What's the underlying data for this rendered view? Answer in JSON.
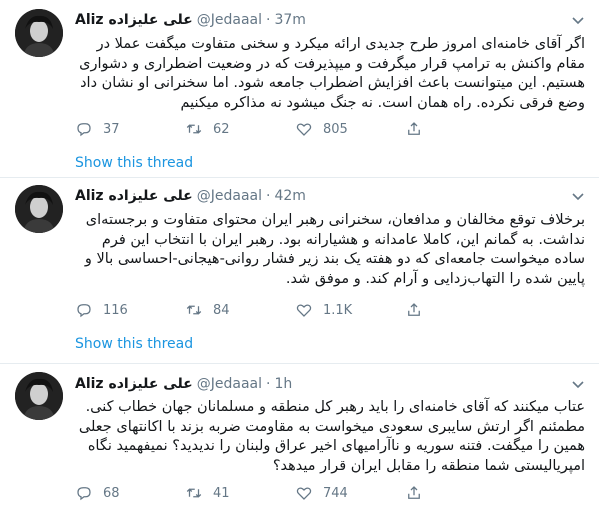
{
  "tweets": [
    {
      "name": "Aliz علی علیزاده",
      "handle": "@Jedaaal",
      "sep": "·",
      "time": "37m",
      "text": "اگر آقای خامنه‌ای امروز طرح جدیدی ارائه میکرد و سخنی متفاوت میگفت عملا در مقام واکنش به ترامپ قرار میگرفت و میپذیرفت که در وضعیت اضطراری و دشواری هستیم. این میتوانست باعث افزایش اضطراب جامعه شود. اما سخنرانی او نشان داد وضع فرقی نکرده. راه همان است. نه جنگ میشود نه مذاکره میکنیم",
      "reply_count": "37",
      "retweet_count": "62",
      "like_count": "805",
      "show_thread": "Show this thread"
    },
    {
      "name": "Aliz علی علیزاده",
      "handle": "@Jedaaal",
      "sep": "·",
      "time": "42m",
      "text": "برخلاف توقع مخالفان و مدافعان، سخنرانی رهبر ایران محتوای متفاوت و برجسته‌ای نداشت. به گمانم این، کاملا عامدانه و هشیارانه بود. رهبر ایران با انتخاب این فرم ساده میخواست جامعه‌ای که دو هفته یک بند زیر فشار روانی-هیجانی-احساسی بالا و پایین شده را التهاب‌زدایی و آرام کند. و موفق شد.",
      "reply_count": "116",
      "retweet_count": "84",
      "like_count": "1.1K",
      "show_thread": "Show this thread"
    },
    {
      "name": "Aliz علی علیزاده",
      "handle": "@Jedaaal",
      "sep": "·",
      "time": "1h",
      "text": "عتاب میکنند که آقای خامنه‌ای را باید رهبر کل منطقه و مسلمانان جهان خطاب کنی. مطمئنم اگر ارتش سایبری سعودی میخواست به مقاومت ضربه بزند با اکانتهای جعلی همین را میگفت. فتنه سوریه و ناآرامیهای اخیر عراق ولبنان را ندیدید؟ نمیفهمید نگاه امپریالیستی شما منطقه را مقابل ایران قرار میدهد؟",
      "reply_count": "68",
      "retweet_count": "41",
      "like_count": "744"
    }
  ],
  "icons": {
    "reply": "reply-icon",
    "retweet": "retweet-icon",
    "like": "heart-icon",
    "share": "share-icon",
    "caret": "chevron-down-icon"
  },
  "colors": {
    "link": "#1b95e0",
    "muted": "#657786",
    "text": "#14171a"
  }
}
